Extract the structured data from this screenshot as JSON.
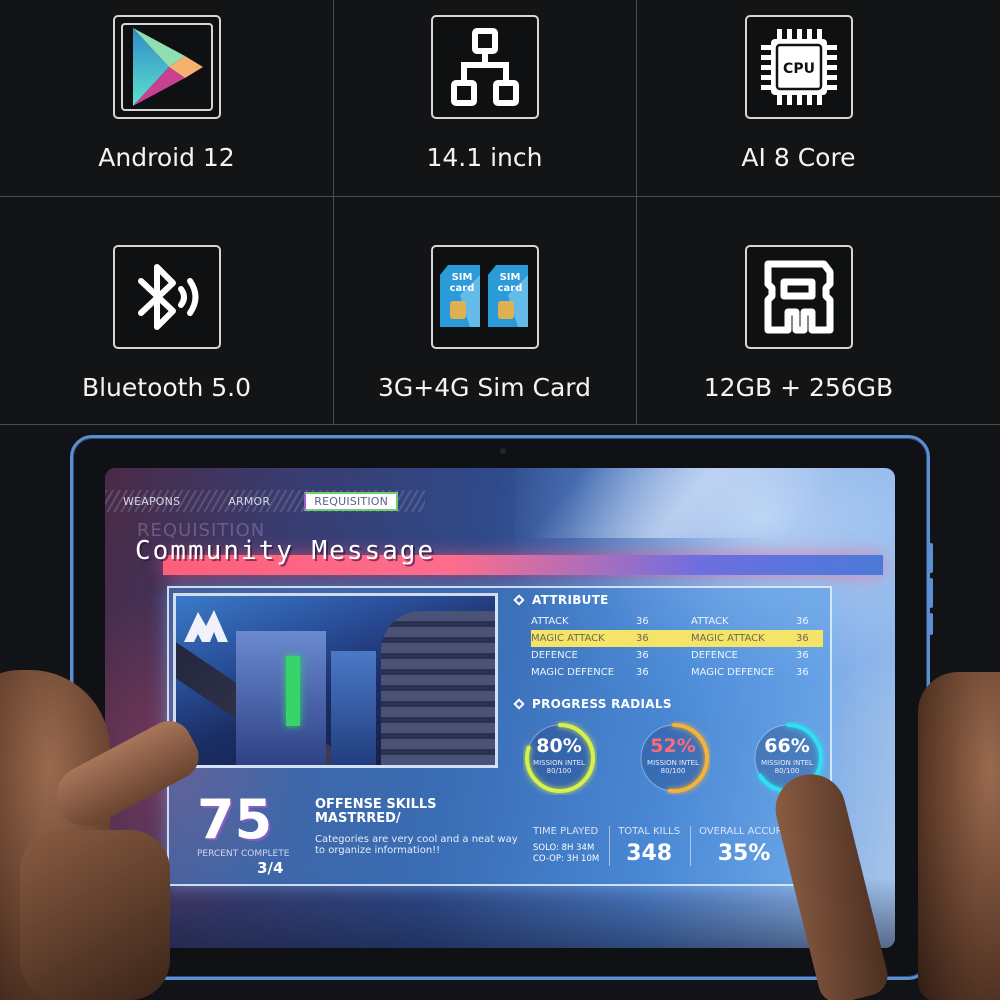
{
  "specs": [
    {
      "icon": "play-store-icon",
      "label": "Android 12"
    },
    {
      "icon": "network-diagram-icon",
      "label": "14.1 inch"
    },
    {
      "icon": "cpu-chip-icon",
      "label": "AI  8 Core",
      "icon_text": "CPU"
    },
    {
      "icon": "bluetooth-icon",
      "label": "Bluetooth 5.0"
    },
    {
      "icon": "sim-card-icon",
      "label": "3G+4G Sim Card",
      "icon_text": [
        "SIM",
        "card"
      ]
    },
    {
      "icon": "memory-card-icon",
      "label": "12GB + 256GB"
    }
  ],
  "screen": {
    "tabs": [
      {
        "label": "WEAPONS",
        "active": false
      },
      {
        "label": "ARMOR",
        "active": false
      },
      {
        "label": "REQUISITION",
        "active": true
      }
    ],
    "ghost_title": "REQUISITION",
    "title": "Community Message",
    "attribute": {
      "heading": "ATTRIBUTE",
      "rows": [
        {
          "name": "ATTACK",
          "value": "36",
          "name2": "ATTACK",
          "value2": "36",
          "highlight": false
        },
        {
          "name": "MAGIC ATTACK",
          "value": "36",
          "name2": "MAGIC ATTACK",
          "value2": "36",
          "highlight": true
        },
        {
          "name": "DEFENCE",
          "value": "36",
          "name2": "DEFENCE",
          "value2": "36",
          "highlight": false
        },
        {
          "name": "MAGIC DEFENCE",
          "value": "36",
          "name2": "MAGIC DEFENCE",
          "value2": "36",
          "highlight": false
        }
      ],
      "highlight_color": "#f4e46a"
    },
    "radials": {
      "heading": "PROGRESS RADIALS",
      "items": [
        {
          "percent": 80,
          "label": "80%",
          "sub1": "MISSION INTEL",
          "sub2": "80/100",
          "color": "#d8f04a",
          "text_color": "#ffffff"
        },
        {
          "percent": 52,
          "label": "52%",
          "sub1": "MISSION INTEL",
          "sub2": "80/100",
          "color": "#f5b23a",
          "text_color": "#ff6a7a"
        },
        {
          "percent": 66,
          "label": "66%",
          "sub1": "MISSION INTEL",
          "sub2": "80/100",
          "color": "#2ee0f0",
          "text_color": "#ffffff"
        }
      ]
    },
    "stats": {
      "time_played": {
        "heading": "TIME PLAYED",
        "solo": "SOLO: 8H 34M",
        "coop": "CO-OP: 3H 10M"
      },
      "total_kills": {
        "heading": "TOTAL KILLS",
        "value": "348"
      },
      "accuracy": {
        "heading": "OVERALL ACCURA",
        "value": "35%"
      }
    },
    "skill": {
      "big_number": "75",
      "percent_label": "PERCENT COMPLETE",
      "fraction": "3/4",
      "heading_line1": "OFFENSE SKILLS",
      "heading_line2": "MASTRRED/",
      "description": "Categories are very cool and a neat way to organize information!!"
    }
  },
  "colors": {
    "tablet_frame": "#5b8fd0",
    "background": "#131416",
    "pink_bar": "#ff6d8c"
  }
}
